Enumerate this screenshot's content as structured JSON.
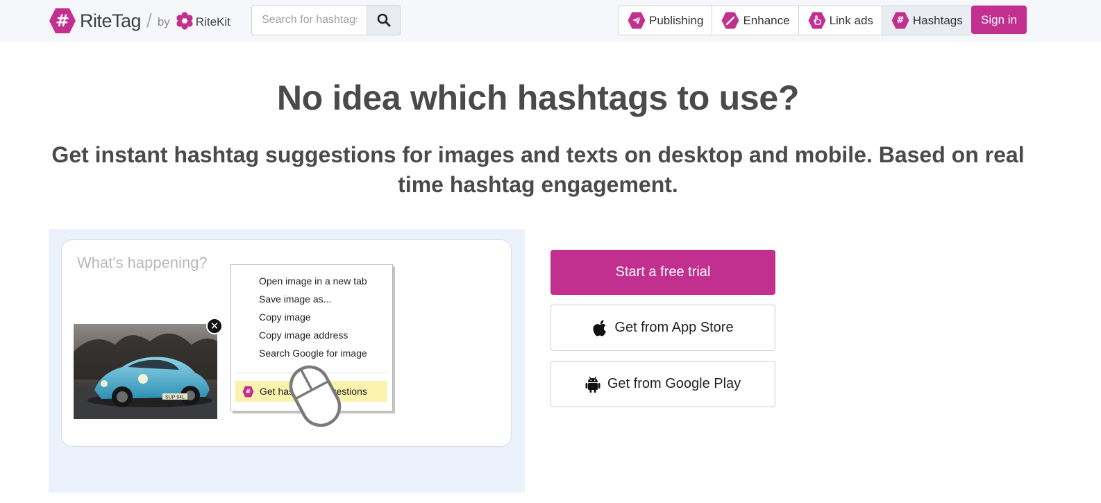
{
  "brand": {
    "logo_glyph": "#",
    "name": "RiteTag",
    "slash": "/",
    "by": "by",
    "parent": "RiteKit"
  },
  "search": {
    "placeholder": "Search for hashtags",
    "value": "",
    "icon": "search-icon"
  },
  "nav": {
    "items": [
      {
        "label": "Publishing",
        "icon": "paper-plane-icon",
        "active": false
      },
      {
        "label": "Enhance",
        "icon": "magic-wand-icon",
        "active": false
      },
      {
        "label": "Link ads",
        "icon": "pointer-hand-icon",
        "active": false
      },
      {
        "label": "Hashtags",
        "icon": "hashtag-icon",
        "active": true
      }
    ],
    "signin_label": "Sign in"
  },
  "hero": {
    "headline": "No idea which hashtags to use?",
    "subhead": "Get instant hashtag suggestions for images and texts on desktop and mobile. Based on real time hashtag engagement."
  },
  "demo": {
    "compose_placeholder": "What's happening?",
    "image_plate": "SUP 94L",
    "context_menu": [
      "Open image in a new tab",
      "Save image as...",
      "Copy image",
      "Copy image address",
      "Search Google for image"
    ],
    "context_highlight": "Get hashtag suggestions",
    "context_highlight_glyph": "#"
  },
  "cta": {
    "trial_label": "Start a free trial",
    "app_store_label": "Get from App Store",
    "google_play_label": "Get from Google Play"
  },
  "colors": {
    "brand": "#c2308f",
    "topbar_bg": "#f5f7fa",
    "demo_bg": "#ebf2fb",
    "highlight": "#fbf2ad"
  }
}
